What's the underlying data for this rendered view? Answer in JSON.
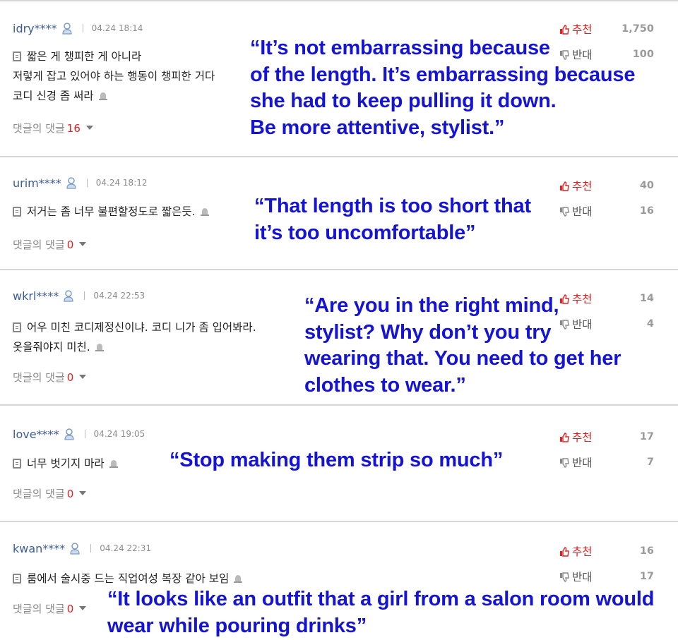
{
  "labels": {
    "upvote": "추천",
    "downvote": "반대",
    "replies": "댓글의 댓글"
  },
  "colors": {
    "translation": "#1414d2",
    "upvote": "#e02020",
    "username": "#3d5c97",
    "reply_count": "#e02020"
  },
  "comments": [
    {
      "username": "idry****",
      "date": "04.24 18:14",
      "lines": [
        "짧은 게 챙피한 게 아니라",
        "저렇게 잡고 있어야 하는 행동이 챙피한 거다",
        "코디 신경 좀 써라"
      ],
      "reply_count": "16",
      "upvotes": "1,750",
      "downvotes": "100",
      "translation": [
        "“It’s not embarrassing because",
        "of the length. It’s embarrassing because",
        "she had to keep pulling it down.",
        "Be more attentive, stylist.”"
      ]
    },
    {
      "username": "urim****",
      "date": "04.24 18:12",
      "lines": [
        "저거는 좀 너무 불편할정도로 짧은듯."
      ],
      "reply_count": "0",
      "upvotes": "40",
      "downvotes": "16",
      "translation": [
        "“That length is too short that",
        "it’s too uncomfortable”"
      ]
    },
    {
      "username": "wkrl****",
      "date": "04.24 22:53",
      "lines": [
        "어우 미친 코디제정신이냐. 코디 니가 좀 입어봐라.",
        "옷을줘야지 미친."
      ],
      "reply_count": "0",
      "upvotes": "14",
      "downvotes": "4",
      "translation": [
        "“Are you in the right mind,",
        "stylist? Why don’t you try",
        "wearing that. You need to get her",
        "clothes to wear.”"
      ]
    },
    {
      "username": "love****",
      "date": "04.24 19:05",
      "lines": [
        "너무 벗기지 마라"
      ],
      "reply_count": "0",
      "upvotes": "17",
      "downvotes": "7",
      "translation": [
        "“Stop making them strip so much”"
      ]
    },
    {
      "username": "kwan****",
      "date": "04.24 22:31",
      "lines": [
        "룸에서 술시중 드는 직업여성 복장 같아 보임"
      ],
      "reply_count": "0",
      "upvotes": "16",
      "downvotes": "17",
      "translation": [
        "“It looks like an outfit that a girl from a salon room would",
        "wear while pouring drinks”"
      ]
    }
  ]
}
